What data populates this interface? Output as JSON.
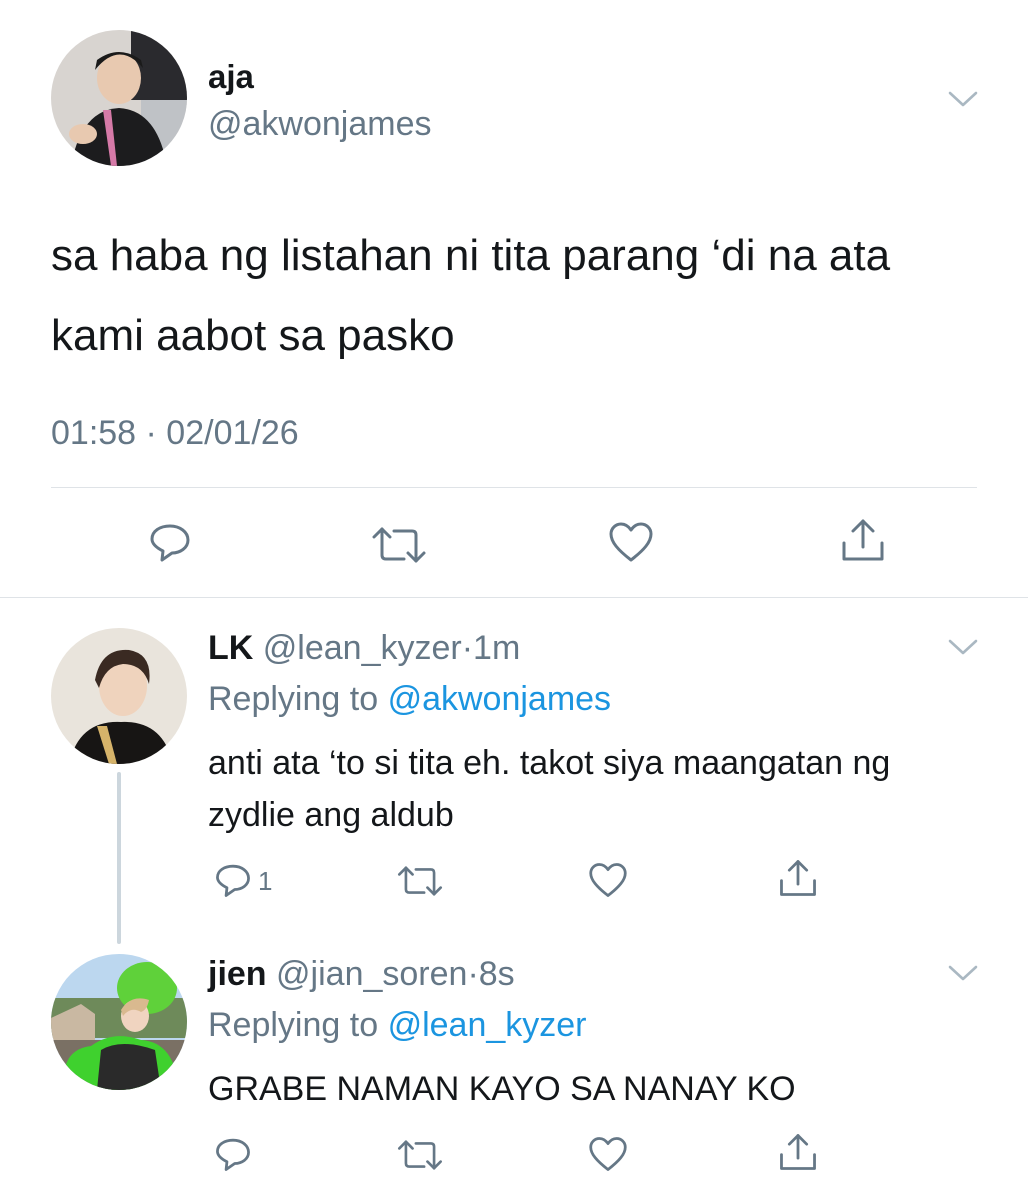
{
  "main_tweet": {
    "display_name": "aja",
    "handle": "@akwonjames",
    "text": "sa haba ng listahan ni tita parang ‘di na ata kami aabot sa pasko",
    "timestamp": "01:58 · 02/01/26"
  },
  "replies": [
    {
      "display_name": "LK",
      "handle": "@lean_kyzer",
      "separator": "·",
      "age": "1m",
      "replying_prefix": "Replying to",
      "replying_to": "@akwonjames",
      "text": "anti ata ‘to si tita eh. takot siya maangatan ng zydlie ang aldub",
      "reply_count": "1"
    },
    {
      "display_name": "jien",
      "handle": "@jian_soren",
      "separator": "·",
      "age": "8s",
      "replying_prefix": "Replying to",
      "replying_to": "@lean_kyzer",
      "text": "GRABE NAMAN KAYO SA NANAY KO",
      "reply_count": ""
    }
  ],
  "colors": {
    "text": "#14171a",
    "secondary": "#657786",
    "link": "#1b95e0",
    "icon": "#657786",
    "divider": "#dfe3e7"
  },
  "icons": [
    "chevron-down-icon",
    "reply-icon",
    "retweet-icon",
    "like-icon",
    "share-icon"
  ]
}
